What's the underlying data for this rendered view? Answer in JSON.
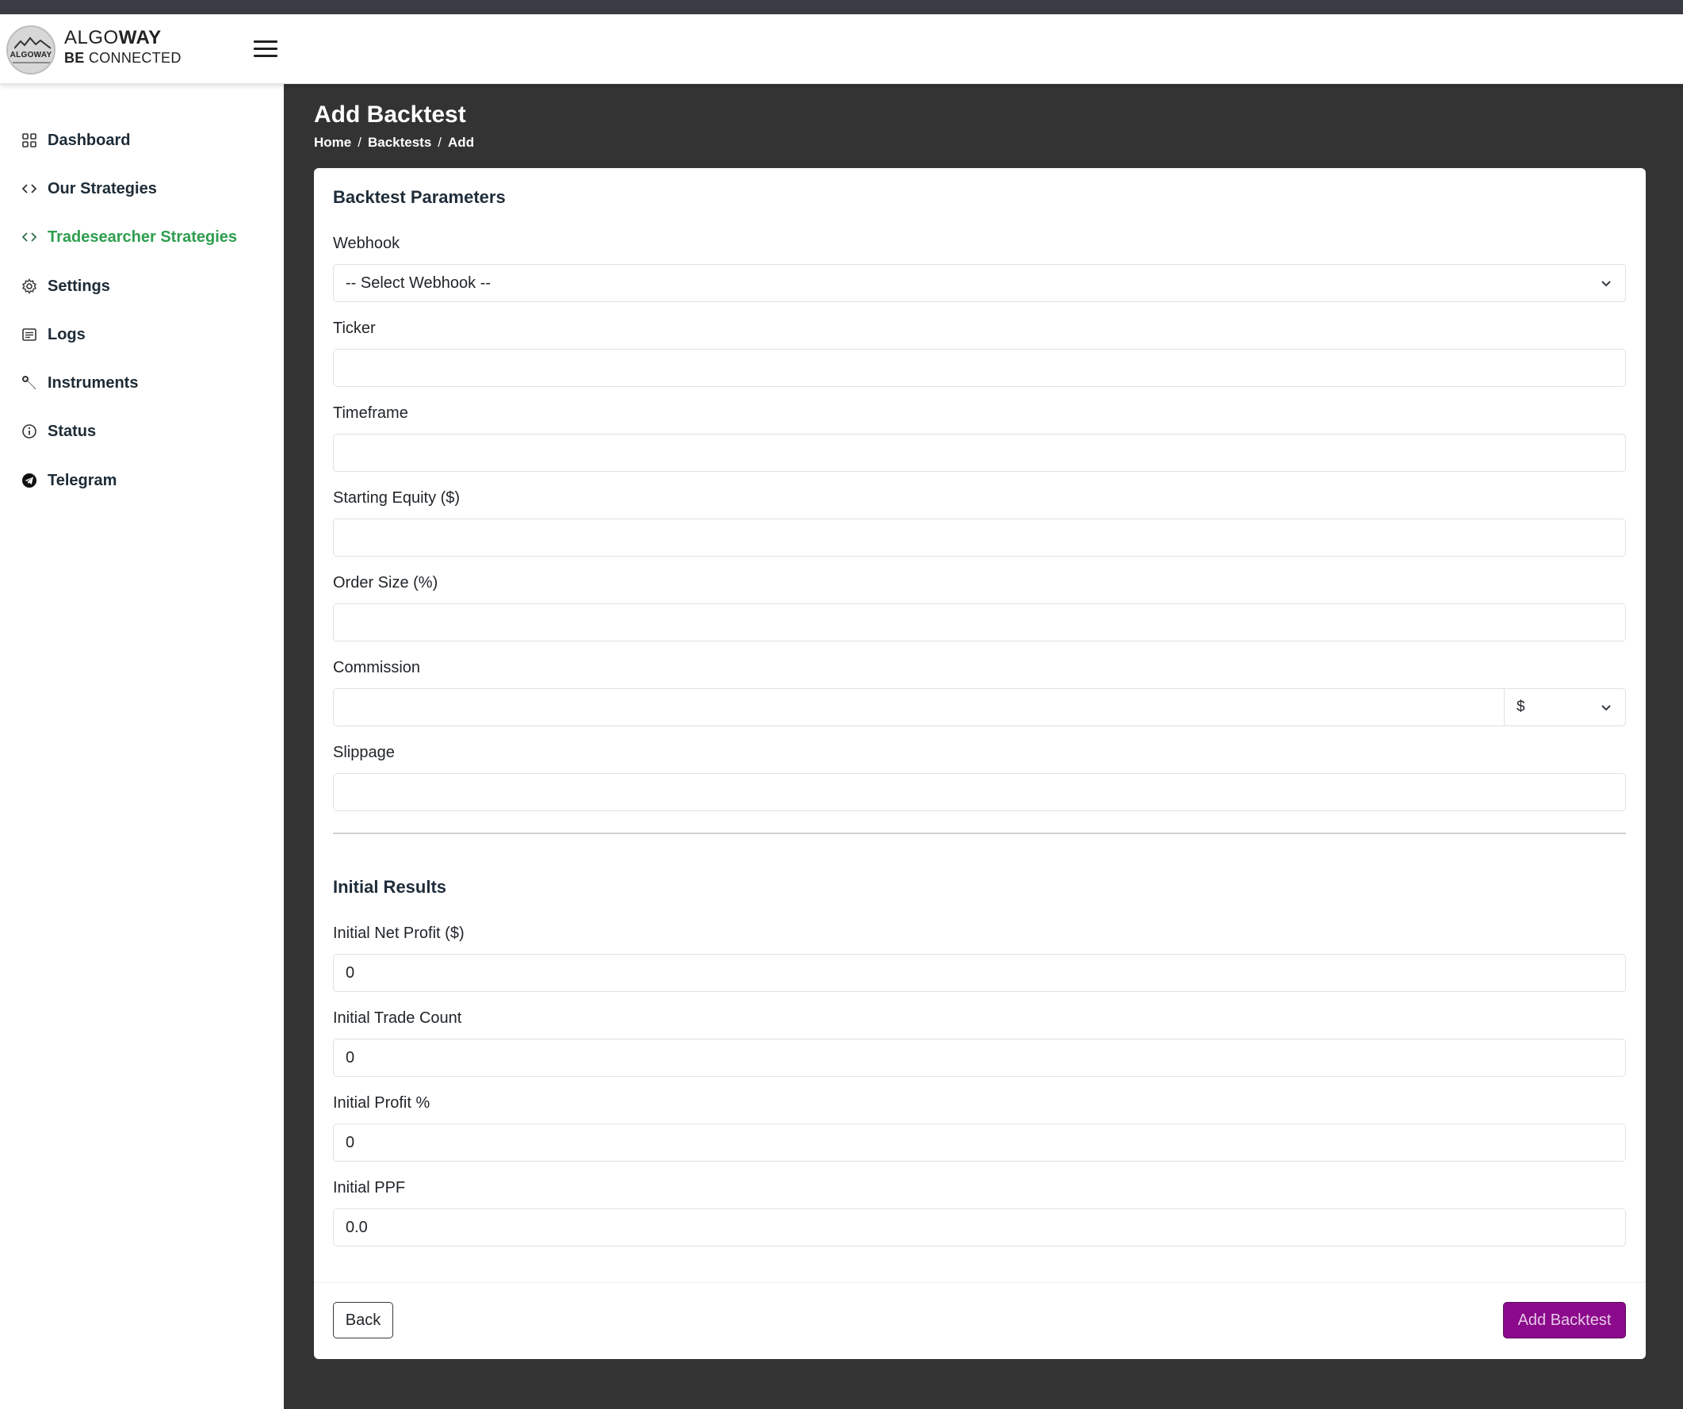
{
  "brand": {
    "name_light": "ALGO",
    "name_bold": "WAY",
    "tagline_bold": "BE",
    "tagline_light": "CONNECTED",
    "logo_text": "ALGOWAY"
  },
  "sidebar": {
    "items": [
      {
        "label": "Dashboard",
        "icon": "grid-icon"
      },
      {
        "label": "Our Strategies",
        "icon": "code-icon"
      },
      {
        "label": "Tradesearcher Strategies",
        "icon": "code-icon",
        "active": true
      },
      {
        "label": "Settings",
        "icon": "gear-icon"
      },
      {
        "label": "Logs",
        "icon": "list-icon"
      },
      {
        "label": "Instruments",
        "icon": "wrench-icon"
      },
      {
        "label": "Status",
        "icon": "info-icon"
      },
      {
        "label": "Telegram",
        "icon": "telegram-icon"
      }
    ],
    "active_color": "#2e9e4e"
  },
  "page": {
    "title": "Add Backtest",
    "breadcrumb": [
      "Home",
      "Backtests",
      "Add"
    ]
  },
  "form": {
    "section1_title": "Backtest Parameters",
    "webhook_label": "Webhook",
    "webhook_value": "-- Select Webhook --",
    "ticker_label": "Ticker",
    "ticker_value": "",
    "timeframe_label": "Timeframe",
    "timeframe_value": "",
    "equity_label": "Starting Equity ($)",
    "equity_value": "",
    "order_size_label": "Order Size (%)",
    "order_size_value": "",
    "commission_label": "Commission",
    "commission_value": "",
    "commission_unit": "$",
    "slippage_label": "Slippage",
    "slippage_value": "",
    "section2_title": "Initial Results",
    "net_profit_label": "Initial Net Profit ($)",
    "net_profit_value": "0",
    "trade_count_label": "Initial Trade Count",
    "trade_count_value": "0",
    "profit_pct_label": "Initial Profit %",
    "profit_pct_value": "0",
    "ppf_label": "Initial PPF",
    "ppf_value": "0.0"
  },
  "buttons": {
    "back": "Back",
    "add": "Add Backtest"
  },
  "colors": {
    "content_bg": "#333333",
    "primary_button": "#8b0a8b"
  }
}
